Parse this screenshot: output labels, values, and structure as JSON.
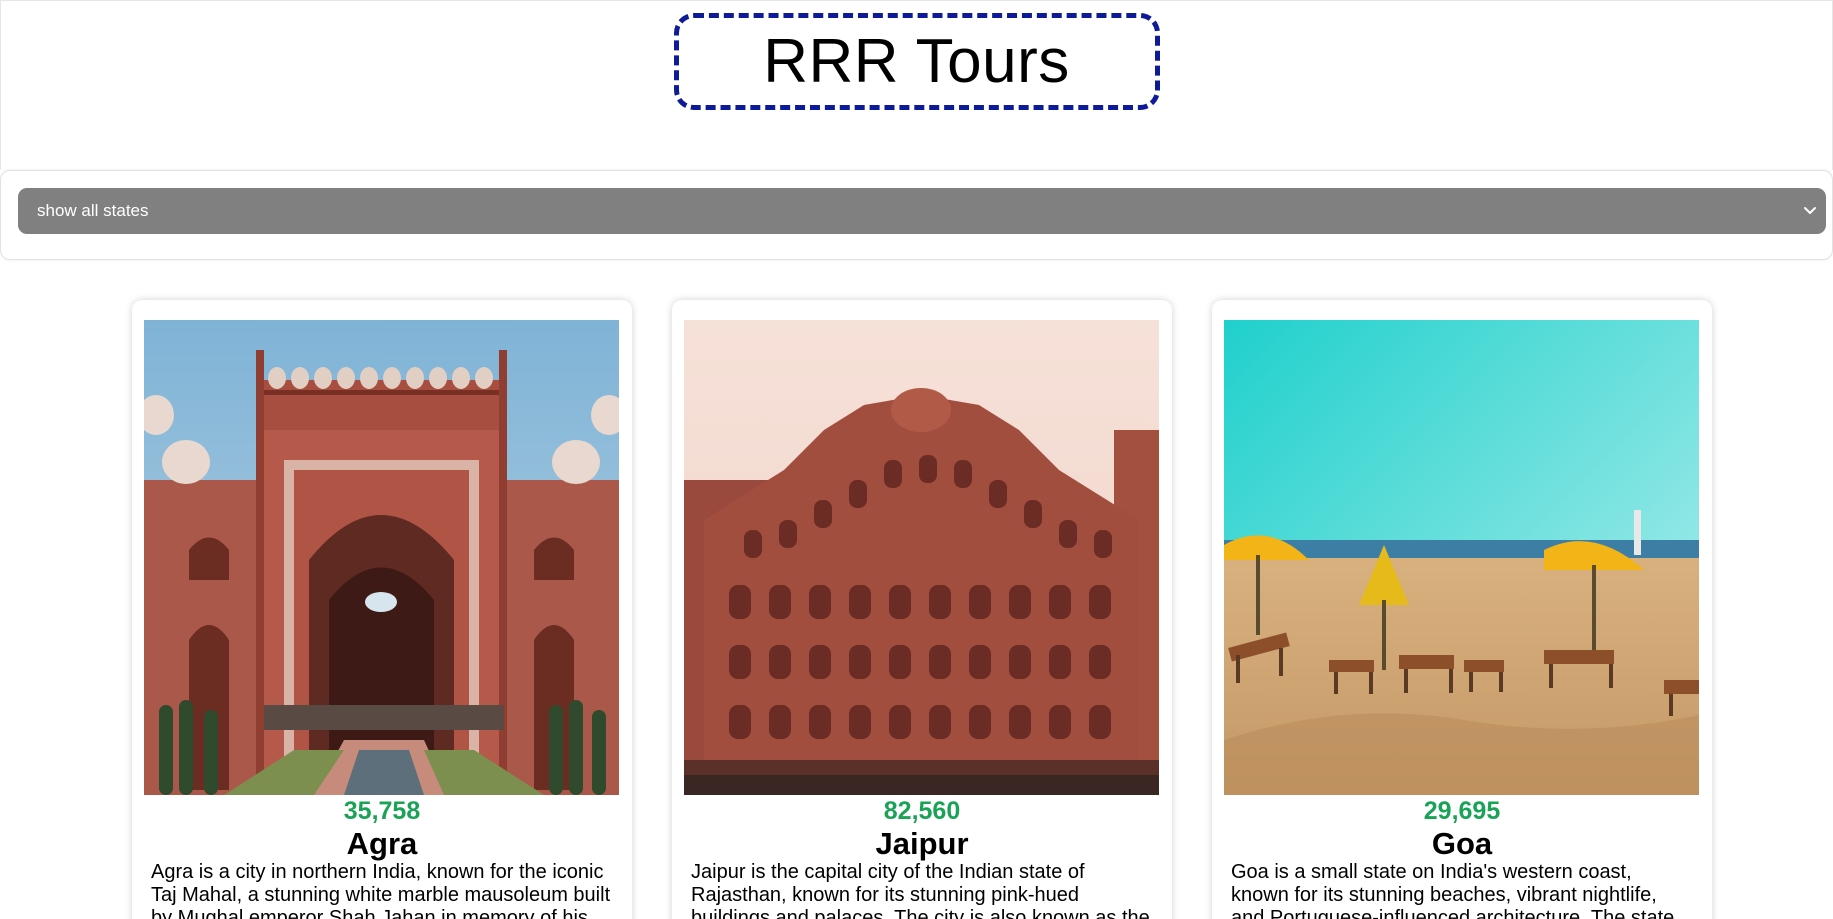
{
  "header": {
    "title": "RRR Tours"
  },
  "filter": {
    "selected": "show all states",
    "icon": "chevron-down-icon"
  },
  "cards": [
    {
      "price": "35,758",
      "name": "Agra",
      "description": "Agra is a city in northern India, known for the iconic Taj Mahal, a stunning white marble mausoleum built by Mughal emperor Shah Jahan in memory of his"
    },
    {
      "price": "82,560",
      "name": "Jaipur",
      "description": "Jaipur is the capital city of the Indian state of Rajasthan, known for its stunning pink-hued buildings and palaces. The city is also known as the"
    },
    {
      "price": "29,695",
      "name": "Goa",
      "description": "Goa is a small state on India's western coast, known for its stunning beaches, vibrant nightlife, and Portuguese-influenced architecture. The state"
    }
  ],
  "colors": {
    "title_border": "#0d1b99",
    "select_bg": "#808080",
    "price": "#1aa356"
  }
}
